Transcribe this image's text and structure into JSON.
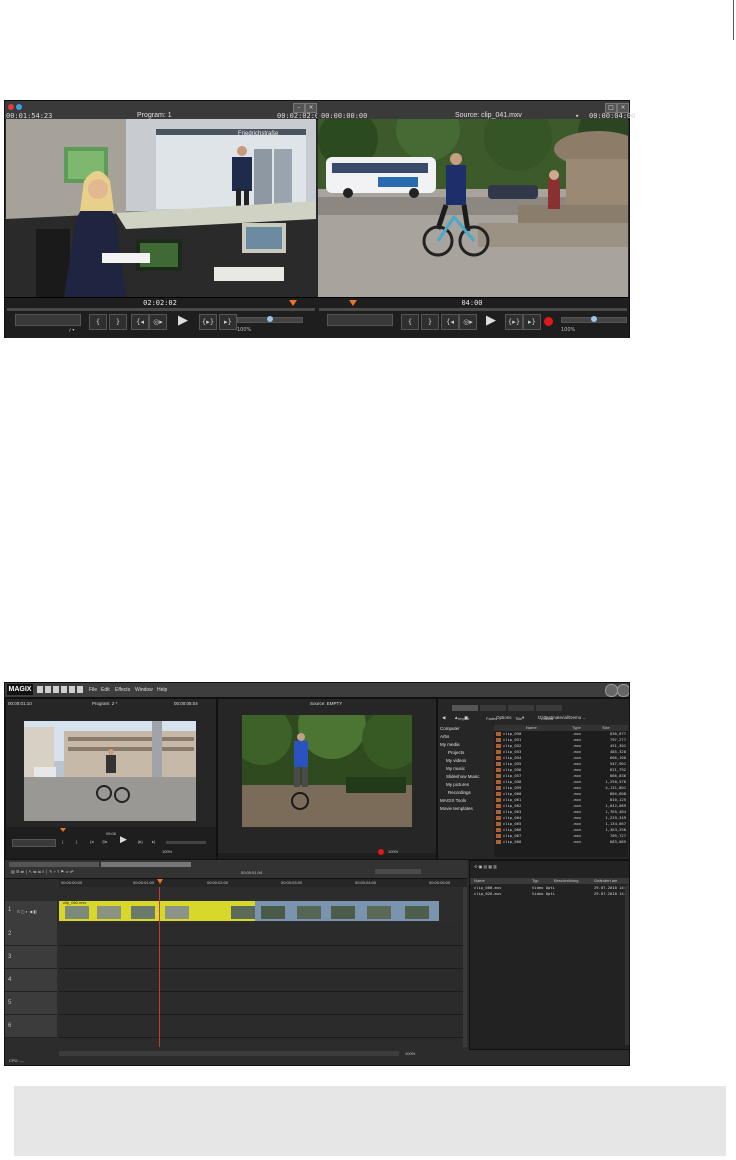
{
  "top_screenshot": {
    "program": {
      "timecode_left": "00:01:54:23",
      "title": "Program: 1",
      "timecode_right": "00:02:02:02",
      "position": "02:02:02",
      "zoom": "100%"
    },
    "source": {
      "timecode_left": "00:00:00:00",
      "title": "Source: clip_041.mxv",
      "timecode_right": "00:00:04:00",
      "position": "04:00",
      "zoom": "100%"
    },
    "scene_sign": "Friedrichstraße"
  },
  "bottom_screenshot": {
    "logo": "MAGIX",
    "menu": [
      "File",
      "Edit",
      "Effects",
      "Window",
      "Help"
    ],
    "program": {
      "timecode_left": "00:00:01:10",
      "title": "Program: 2 *",
      "timecode_right": "00:00:05:04",
      "position": "05:06",
      "zoom": "100%"
    },
    "source": {
      "title": "Source: EMPTY",
      "zoom": "100%"
    },
    "media_pool": {
      "tabs": [
        "Import",
        "Fades",
        "Title",
        "Effects"
      ],
      "options_label": "Options",
      "path": "D:\\Testmaterial\\Demo ...",
      "columns": [
        "Name",
        "Type",
        "Size"
      ],
      "tree": [
        "Computer",
        "Arbs",
        "My media",
        "Projects",
        "My videos",
        "My music",
        "Slideshow Music",
        "My pictures",
        "Recordings",
        "MAGIX Tools",
        "Movie templates"
      ],
      "files": [
        {
          "name": "clip_050",
          "type": ".mxv",
          "size": "830,877"
        },
        {
          "name": "clip_051",
          "type": ".mxv",
          "size": "797,277"
        },
        {
          "name": "clip_052",
          "type": ".mxv",
          "size": "451,301"
        },
        {
          "name": "clip_053",
          "type": ".mxv",
          "size": "485,328"
        },
        {
          "name": "clip_054",
          "type": ".mxv",
          "size": "666,100"
        },
        {
          "name": "clip_055",
          "type": ".mxv",
          "size": "547,901"
        },
        {
          "name": "clip_056",
          "type": ".mxv",
          "size": "621,792"
        },
        {
          "name": "clip_057",
          "type": ".mxv",
          "size": "866,836"
        },
        {
          "name": "clip_058",
          "type": ".mxv",
          "size": "1,250,576"
        },
        {
          "name": "clip_059",
          "type": ".mxv",
          "size": "4,131,801"
        },
        {
          "name": "clip_060",
          "type": ".mxv",
          "size": "804,608"
        },
        {
          "name": "clip_061",
          "type": ".mxv",
          "size": "810,125"
        },
        {
          "name": "clip_062",
          "type": ".mxv",
          "size": "1,042,089"
        },
        {
          "name": "clip_063",
          "type": ".mxv",
          "size": "1,765,484"
        },
        {
          "name": "clip_064",
          "type": ".mxv",
          "size": "1,229,349"
        },
        {
          "name": "clip_065",
          "type": ".mxv",
          "size": "1,134,667"
        },
        {
          "name": "clip_066",
          "type": ".mxv",
          "size": "1,363,256"
        },
        {
          "name": "clip_067",
          "type": ".mxv",
          "size": "709,727"
        },
        {
          "name": "clip_068",
          "type": ".mxv",
          "size": "683,085"
        }
      ]
    },
    "timeline": {
      "position": "00:00:01:04",
      "ruler_marks": [
        "00:00:00:00",
        "00:00:01:00",
        "00:00:02:00",
        "00:00:03:00",
        "00:00:04:00",
        "00:00:05:00"
      ],
      "track_numbers": [
        "1",
        "2",
        "3",
        "4",
        "5",
        "6"
      ],
      "clip_label": "clip_060.mxv",
      "zoom": "100%"
    },
    "project_files": {
      "columns": [
        "Name",
        "Typ",
        "Beschreibung",
        "Geändert am"
      ],
      "rows": [
        {
          "name": "clip_060.mxv",
          "type": "Video Opti",
          "desc": "",
          "date": "29.07.2010 14:"
        },
        {
          "name": "clip_026.mxv",
          "type": "Video Opti",
          "desc": "",
          "date": "29.07.2010 14:"
        }
      ]
    },
    "status": "CPU: —"
  }
}
